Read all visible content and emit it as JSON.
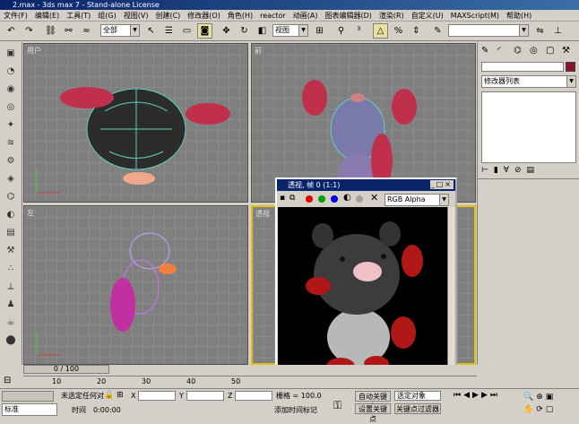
{
  "window": {
    "title": "2.max - 3ds max 7  - Stand-alone License"
  },
  "menu": [
    "文件(F)",
    "编辑(E)",
    "工具(T)",
    "组(G)",
    "视图(V)",
    "创建(C)",
    "修改器(O)",
    "角色(H)",
    "reactor",
    "动画(A)",
    "图表编辑器(D)",
    "渲染(R)",
    "自定义(U)",
    "MAXScript(M)",
    "帮助(H)"
  ],
  "toolbar": {
    "selection_filter": "全部",
    "coord_system": "视图"
  },
  "viewports": {
    "top": "用户",
    "front": "前",
    "left": "左",
    "persp": "透视"
  },
  "command_panel": {
    "modifier_list": "修改器列表"
  },
  "render_window": {
    "title": "透视, 帧 0 (1:1)",
    "channel": "RGB Alpha"
  },
  "timeline": {
    "frame": "0 / 100",
    "ticks": [
      "0",
      "10",
      "20",
      "30",
      "40",
      "50"
    ]
  },
  "status": {
    "mode_label": "标准",
    "selection": "未选定任何对",
    "x_label": "X",
    "y_label": "Y",
    "z_label": "Z",
    "grid": "栅格 = 100.0",
    "add_time_tag": "添加时间标记",
    "time_label": "时间",
    "time_value": "0:00:00",
    "auto_key": "自动关键点",
    "selected_obj": "选定对象",
    "set_key": "设置关键点",
    "key_filter": "关键点过滤器"
  },
  "colors": {
    "title_bg": "#0a246a",
    "viewport_bg": "#7f7f7f",
    "panel_bg": "#d4d0c8",
    "auto_key_red": "#c00000"
  }
}
